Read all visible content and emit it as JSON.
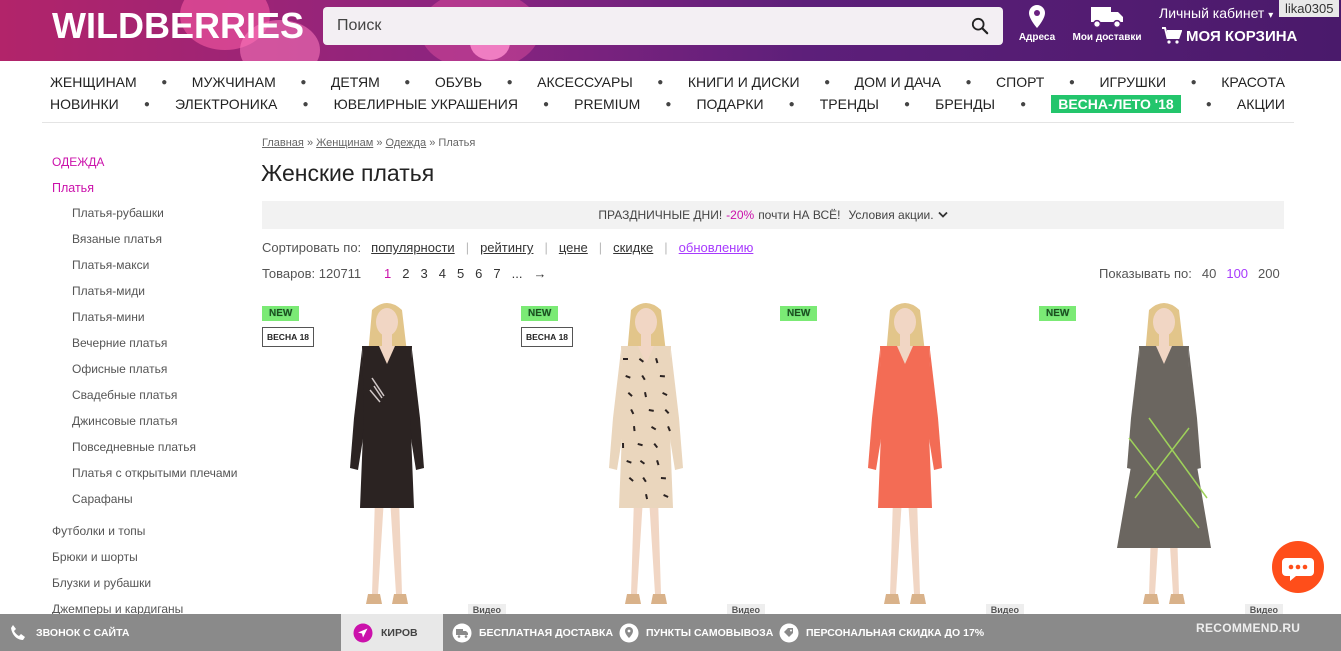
{
  "header": {
    "logo": "WILDBERRIES",
    "search_placeholder": "Поиск",
    "addresses_label": "Адреса",
    "deliveries_label": "Мои доставки",
    "cabinet_label": "Личный кабинет",
    "cart_label": "МОЯ КОРЗИНА",
    "username": "lika0305"
  },
  "nav": {
    "row1": [
      "ЖЕНЩИНАМ",
      "МУЖЧИНАМ",
      "ДЕТЯМ",
      "ОБУВЬ",
      "АКСЕССУАРЫ",
      "КНИГИ И ДИСКИ",
      "ДОМ И ДАЧА",
      "СПОРТ",
      "ИГРУШКИ",
      "КРАСОТА"
    ],
    "row2": [
      "НОВИНКИ",
      "ЭЛЕКТРОНИКА",
      "ЮВЕЛИРНЫЕ УКРАШЕНИЯ",
      "PREMIUM",
      "ПОДАРКИ",
      "ТРЕНДЫ",
      "БРЕНДЫ",
      "ВЕСНА-ЛЕТО '18",
      "АКЦИИ"
    ],
    "promo_color": "#23c56c"
  },
  "sidebar": {
    "category": "ОДЕЖДА",
    "subcategory": "Платья",
    "items": [
      "Платья-рубашки",
      "Вязаные платья",
      "Платья-макси",
      "Платья-миди",
      "Платья-мини",
      "Вечерние платья",
      "Офисные платья",
      "Свадебные платья",
      "Джинсовые платья",
      "Повседневные платья",
      "Платья с открытыми плечами",
      "Сарафаны"
    ],
    "top_items": [
      "Футболки и топы",
      "Брюки и шорты",
      "Блузки и рубашки",
      "Джемперы и кардиганы"
    ]
  },
  "breadcrumb": {
    "items": [
      "Главная",
      "Женщинам",
      "Одежда"
    ],
    "current": "Платья",
    "separator": "»"
  },
  "page_title": "Женские платья",
  "banner": {
    "text_before": "ПРАЗДНИЧНЫЕ ДНИ!",
    "percent": "-20%",
    "text_after": "почти НА ВСЁ!",
    "conditions": "Условия акции."
  },
  "sort": {
    "label": "Сортировать по:",
    "options": [
      "популярности",
      "рейтингу",
      "цене",
      "скидке",
      "обновлению"
    ],
    "active": "обновлению"
  },
  "listing": {
    "count_label": "Товаров:",
    "count": "120711",
    "pages": [
      "1",
      "2",
      "3",
      "4",
      "5",
      "6",
      "7",
      "...",
      "→"
    ],
    "current_page": "1",
    "perpage_label": "Показывать по:",
    "perpage_options": [
      "40",
      "100",
      "200"
    ],
    "perpage_current": "100"
  },
  "products": [
    {
      "new_badge": "NEW",
      "season_badge": "ВЕСНА 18",
      "video": "Видео",
      "dress_color": "#2b2322"
    },
    {
      "new_badge": "NEW",
      "season_badge": "ВЕСНА 18",
      "video": "Видео",
      "dress_color": "#ead6bd"
    },
    {
      "new_badge": "NEW",
      "season_badge": "",
      "video": "Видео",
      "dress_color": "#f36c55"
    },
    {
      "new_badge": "NEW",
      "season_badge": "",
      "video": "Видео",
      "dress_color": "#6b6660"
    }
  ],
  "bottom_bar": {
    "call": "ЗВОНОК С САЙТА",
    "city": "КИРОВ",
    "delivery": "БЕСПЛАТНАЯ ДОСТАВКА",
    "pickup": "ПУНКТЫ САМОВЫВОЗА",
    "discount": "ПЕРСОНАЛЬНАЯ СКИДКА ДО 17%"
  },
  "watermark": "RECOMMEND.RU",
  "colors": {
    "accent": "#cb11ab",
    "sort_active": "#a73afd",
    "chat": "#ff4e1a",
    "bottom_bar": "#8a8a8a"
  }
}
